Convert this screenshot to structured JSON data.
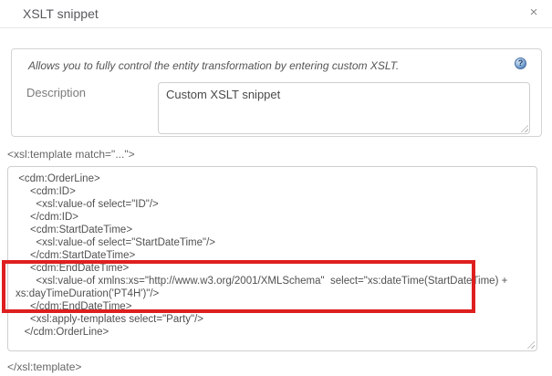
{
  "dialog": {
    "title": "XSLT snippet",
    "close_icon": "×"
  },
  "info_panel": {
    "hint": "Allows you to fully control the entity transformation by entering custom XSLT.",
    "help_icon_glyph": "?",
    "fields": {
      "description": {
        "label": "Description",
        "value": "Custom XSLT snippet"
      }
    }
  },
  "xslt_editor": {
    "template_open_label": "<xsl:template match=\"...\">",
    "template_close_label": "</xsl:template>",
    "code_lines": [
      " <cdm:OrderLine>",
      "     <cdm:ID>",
      "       <xsl:value-of select=\"ID\"/>",
      "     </cdm:ID>",
      "     <cdm:StartDateTime>",
      "       <xsl:value-of select=\"StartDateTime\"/>",
      "     </cdm:StartDateTime>",
      "     <cdm:EndDateTime>",
      "       <xsl:value-of xmlns:xs=\"http://www.w3.org/2001/XMLSchema\"  select=\"xs:dateTime(StartDateTime) +",
      "xs:dayTimeDuration('PT4H')\"/>",
      "     </cdm:EndDateTime>",
      "     <xsl:apply-templates select=\"Party\"/>",
      "   </cdm:OrderLine>"
    ],
    "highlighted_lines": {
      "from": 8,
      "to": 11
    }
  },
  "colors": {
    "highlight_border": "#de1f1f",
    "help_icon_blue": "#5b87be",
    "text_primary": "#515151"
  }
}
